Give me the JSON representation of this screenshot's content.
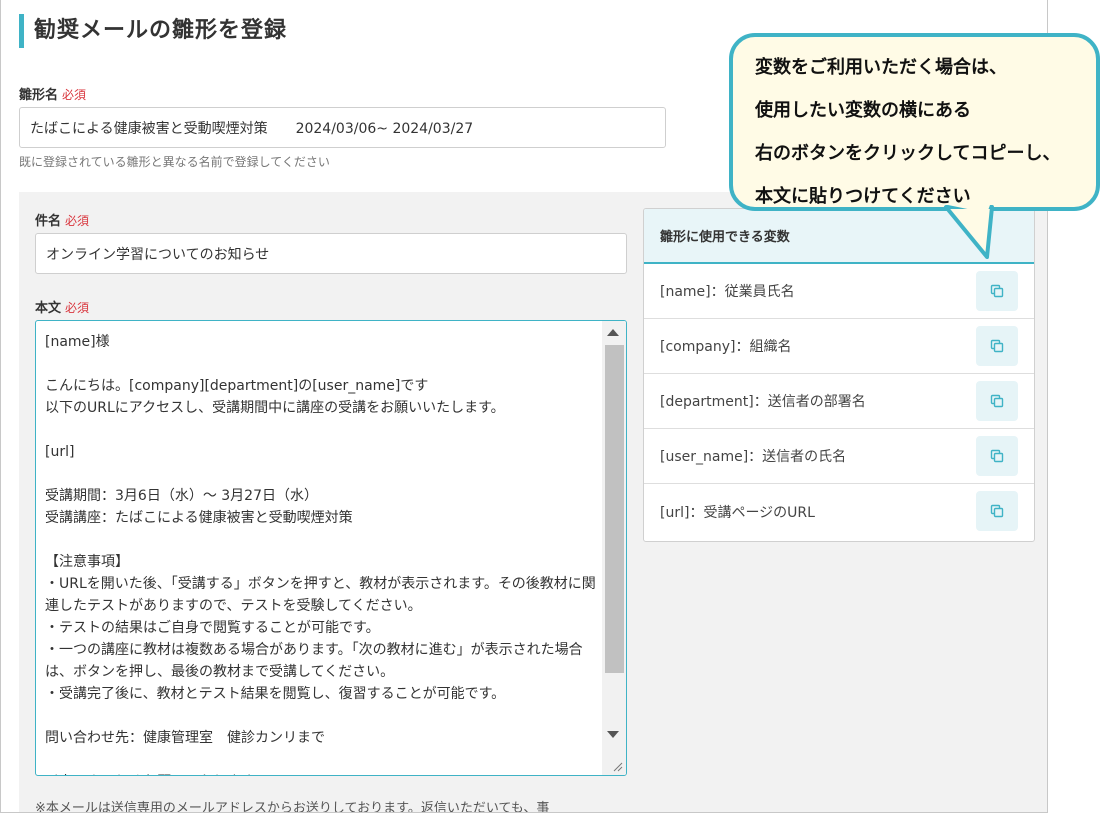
{
  "page": {
    "title": "勧奨メールの雛形を登録"
  },
  "template_name": {
    "label": "雛形名",
    "required": "必須",
    "value": "たばこによる健康被害と受動喫煙対策　　2024/03/06~ 2024/03/27",
    "hint": "既に登録されている雛形と異なる名前で登録してください"
  },
  "subject": {
    "label": "件名",
    "required": "必須",
    "value": "オンライン学習についてのお知らせ"
  },
  "body": {
    "label": "本文",
    "required": "必須",
    "value": "[name]様\n\nこんにちは。[company][department]の[user_name]です\n以下のURLにアクセスし、受講期間中に講座の受講をお願いいたします。\n\n[url]\n\n受講期間：3月6日（水）～ 3月27日（水）\n受講講座：たばこによる健康被害と受動喫煙対策\n\n【注意事項】\n・URLを開いた後、「受講する」ボタンを押すと、教材が表示されます。その後教材に関連したテストがありますので、テストを受験してください。\n・テストの結果はご自身で閲覧することが可能です。\n・一つの講座に教材は複数ある場合があります。「次の教材に進む」が表示された場合は、ボタンを押し、最後の教材まで受講してください。\n・受講完了後に、教材とテスト結果を閲覧し、復習することが可能です。\n\n問い合わせ先：健康管理室　健診カンリまで\n\n以上、よろしくお願いいたします。"
  },
  "footer_note": "※本メールは送信専用のメールアドレスからお送りしております。返信いただいても、事",
  "variables": {
    "header": "雛形に使用できる変数",
    "items": [
      {
        "label": "[name]：従業員氏名"
      },
      {
        "label": "[company]：組織名"
      },
      {
        "label": "[department]：送信者の部署名"
      },
      {
        "label": "[user_name]：送信者の氏名"
      },
      {
        "label": "[url]：受講ページのURL"
      }
    ]
  },
  "callout": {
    "text": "変数をご利用いただく場合は、\n使用したい変数の横にある\n右のボタンをクリックしてコピーし、\n本文に貼りつけてください"
  },
  "colors": {
    "accent": "#3fb3c6",
    "required": "#d9363e",
    "callout_bg": "#fffbe6"
  }
}
